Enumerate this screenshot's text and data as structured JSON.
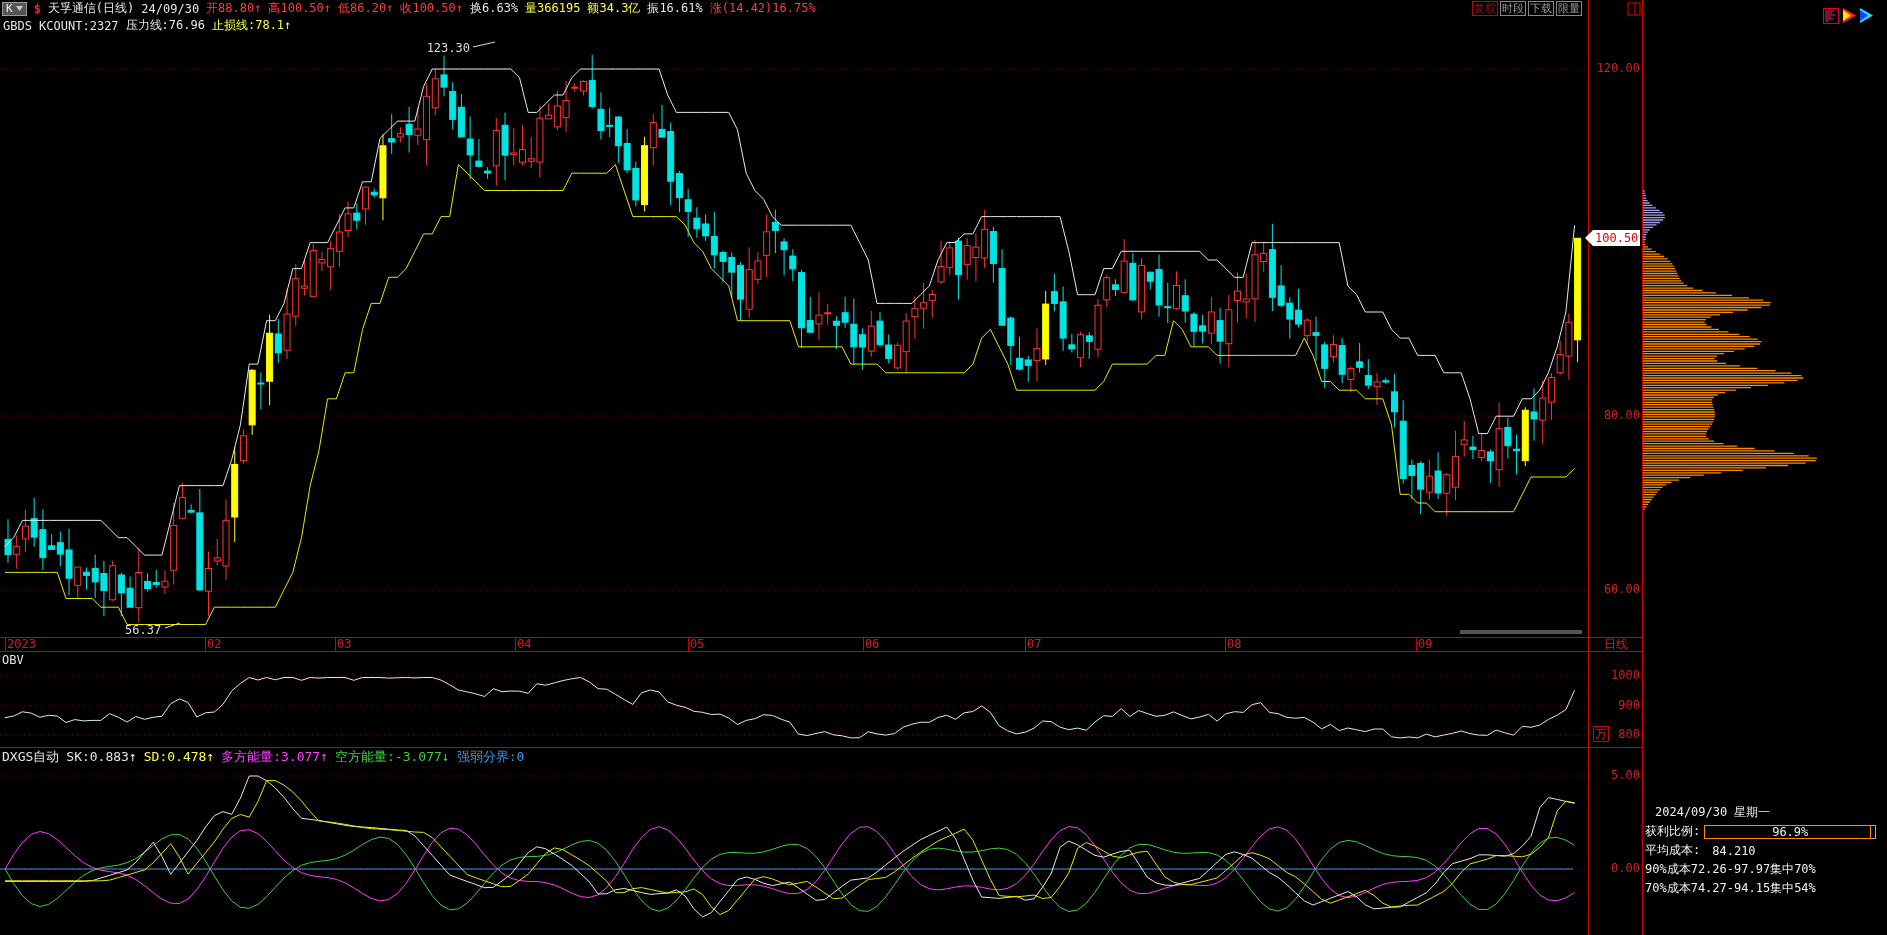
{
  "quote_bar": {
    "symbol_button": "K",
    "market_mark": "$",
    "title": "天孚通信(日线)",
    "date": "24/09/30",
    "items": [
      {
        "text": "开88.80↑",
        "color": "#ff3c3c"
      },
      {
        "text": "高100.50↑",
        "color": "#ff3c3c"
      },
      {
        "text": "低86.20↑",
        "color": "#ff3c3c"
      },
      {
        "text": "收100.50↑",
        "color": "#ff3c3c"
      },
      {
        "text": "换6.63%",
        "color": "#e6e6e6"
      },
      {
        "text": "量366195",
        "color": "#ffff3c"
      },
      {
        "text": "额34.3亿",
        "color": "#ffff3c"
      },
      {
        "text": "振16.61%",
        "color": "#e6e6e6"
      },
      {
        "text": "涨(14.42)16.75%",
        "color": "#ff3c3c"
      }
    ]
  },
  "toolbar": [
    {
      "label": "复权",
      "selected": true
    },
    {
      "label": "时段",
      "selected": false
    },
    {
      "label": "下载",
      "selected": false
    },
    {
      "label": "限量",
      "selected": false
    }
  ],
  "indicator_bar": [
    {
      "text": "GBDS KCOUNT:2327",
      "color": "#e6e6e6"
    },
    {
      "text": "压力线:76.96",
      "color": "#e6e6e6"
    },
    {
      "text": "止损线:78.1↑",
      "color": "#ffff3c"
    }
  ],
  "price_chart": {
    "y_ticks": [
      "120.00",
      "80.00",
      "60.00"
    ],
    "high_label": "123.30",
    "low_label": "56.37",
    "last_price_tag": "100.50",
    "period_label": "日线",
    "date_labels": [
      "2023",
      "02",
      "03",
      "04",
      "05",
      "06",
      "07",
      "08",
      "09"
    ]
  },
  "obv_panel": {
    "title": "OBV",
    "y_ticks": [
      "1000",
      "900",
      "800"
    ],
    "unit": "万"
  },
  "dxgs_panel": {
    "legend": [
      {
        "text": "DXGS自动",
        "color": "#e6e6e6"
      },
      {
        "text": "SK:0.883↑",
        "color": "#e6e6e6"
      },
      {
        "text": "SD:0.478↑",
        "color": "#ffff3c"
      },
      {
        "text": "多方能量:3.077↑",
        "color": "#ff3cff"
      },
      {
        "text": "空方能量:-3.077↓",
        "color": "#3cd23c"
      },
      {
        "text": "强弱分界:0",
        "color": "#3c9be6"
      }
    ],
    "y_ticks": [
      "5.00",
      "0.00"
    ]
  },
  "chip_info": {
    "date": "2024/09/30 星期一",
    "profit_label": "获利比例:",
    "profit_value": "96.9%",
    "level": 0.969,
    "avg_cost_label": "平均成本:",
    "avg_cost_value": "84.210",
    "lines": [
      "90%成本72.26-97.97集中70%",
      "70%成本74.27-94.15集中54%"
    ]
  }
}
